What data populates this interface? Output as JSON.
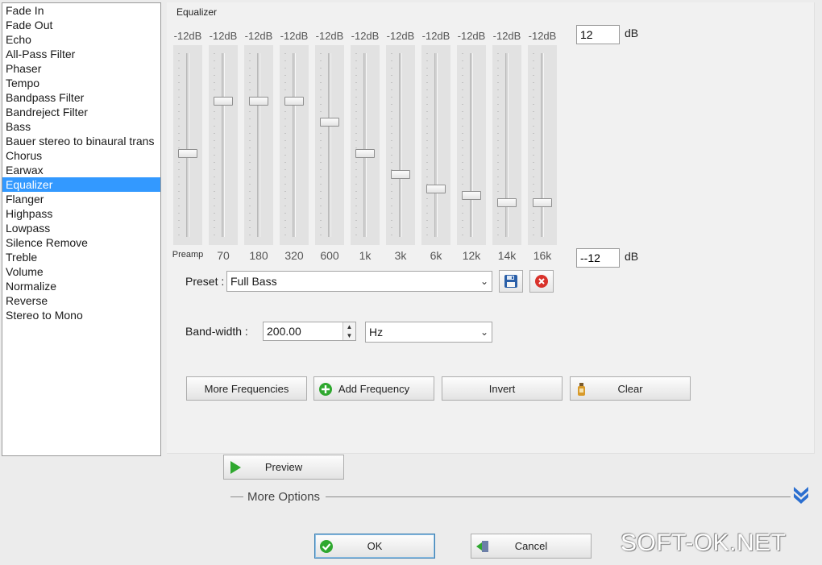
{
  "effects": {
    "items": [
      "Fade In",
      "Fade Out",
      "Echo",
      "All-Pass Filter",
      "Phaser",
      "Tempo",
      "Bandpass Filter",
      "Bandreject Filter",
      "Bass",
      "Bauer stereo to binaural trans",
      "Chorus",
      "Earwax",
      "Equalizer",
      "Flanger",
      "Highpass",
      "Lowpass",
      "Silence Remove",
      "Treble",
      "Volume",
      "Normalize",
      "Reverse",
      "Stereo to Mono"
    ],
    "selected_index": 12
  },
  "equalizer": {
    "title": "Equalizer",
    "bands": [
      {
        "db_label": "-12dB",
        "label": "Preamp",
        "level": 0.45
      },
      {
        "db_label": "-12dB",
        "label": "70",
        "level": 0.75
      },
      {
        "db_label": "-12dB",
        "label": "180",
        "level": 0.75
      },
      {
        "db_label": "-12dB",
        "label": "320",
        "level": 0.75
      },
      {
        "db_label": "-12dB",
        "label": "600",
        "level": 0.63
      },
      {
        "db_label": "-12dB",
        "label": "1k",
        "level": 0.45
      },
      {
        "db_label": "-12dB",
        "label": "3k",
        "level": 0.33
      },
      {
        "db_label": "-12dB",
        "label": "6k",
        "level": 0.25
      },
      {
        "db_label": "-12dB",
        "label": "12k",
        "level": 0.21
      },
      {
        "db_label": "-12dB",
        "label": "14k",
        "level": 0.17
      },
      {
        "db_label": "-12dB",
        "label": "16k",
        "level": 0.17
      }
    ],
    "max_db": "12",
    "min_db": "--12",
    "db_unit": "dB"
  },
  "preset": {
    "label": "Preset :",
    "value": "Full Bass"
  },
  "bandwidth": {
    "label": "Band-width :",
    "value": "200.00",
    "unit": "Hz"
  },
  "buttons": {
    "more_frequencies": "More Frequencies",
    "add_frequency": "Add Frequency",
    "invert": "Invert",
    "clear": "Clear",
    "preview": "Preview",
    "ok": "OK",
    "cancel": "Cancel"
  },
  "more_options": "More Options",
  "watermark": "SOFT-OK.NET",
  "colors": {
    "selection": "#3399ff",
    "play_green": "#2fa82f",
    "delete_red": "#d9322b",
    "save_blue": "#2a5fa8"
  }
}
